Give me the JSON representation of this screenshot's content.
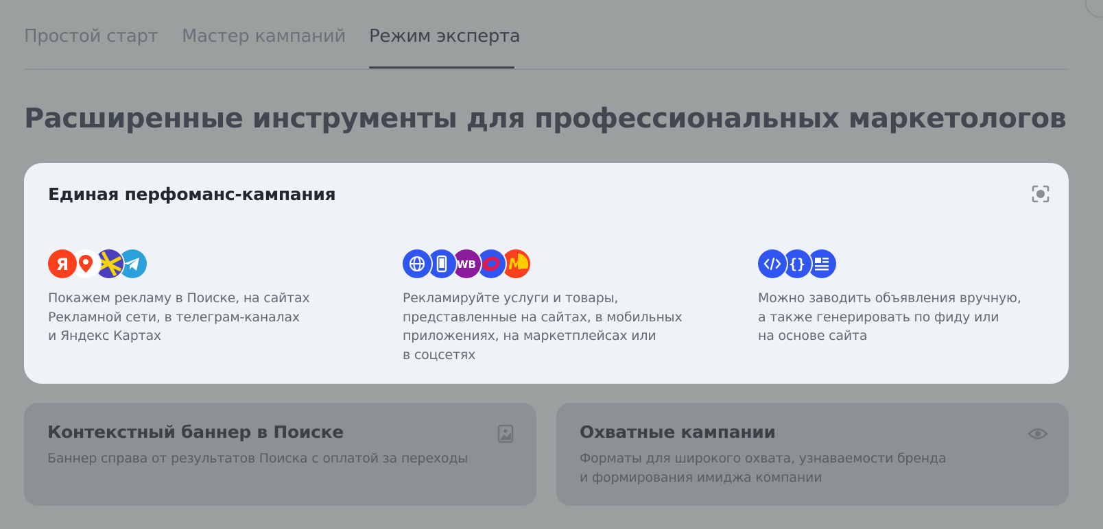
{
  "tabs": [
    {
      "label": "Простой старт"
    },
    {
      "label": "Мастер кампаний"
    },
    {
      "label": "Режим эксперта",
      "active": true
    }
  ],
  "page_title": "Расширенные инструменты для профессиональных маркетологов",
  "main_card": {
    "title": "Единая перфоманс-кампания",
    "expand_icon": "fullscreen-icon",
    "columns": [
      {
        "icons": [
          "yandex-search-icon",
          "yandex-maps-icon",
          "yandex-network-icon",
          "telegram-icon"
        ],
        "lines": [
          "Покажем рекламу в Поиске, на сайтах",
          "Рекламной сети, в телеграм-каналах",
          "и Яндекс Картах"
        ]
      },
      {
        "icons": [
          "website-icon",
          "mobile-app-icon",
          "wildberries-icon",
          "marketplace-icon",
          "yandex-market-icon"
        ],
        "icon_text": {
          "wildberries": "WB",
          "market": "M"
        },
        "lines": [
          "Рекламируйте услуги и товары,",
          "представленные на сайтах, в мобильных",
          "приложениях, на маркетплейсах или",
          "в соцсетях"
        ]
      },
      {
        "icons": [
          "code-icon",
          "feed-braces-icon",
          "site-content-icon"
        ],
        "icon_text": {
          "braces": "{}"
        },
        "lines": [
          "Можно заводить объявления вручную,",
          "а также генерировать по фиду или",
          "на основе сайта"
        ]
      }
    ]
  },
  "small_cards": [
    {
      "title": "Контекстный баннер в Поиске",
      "icon": "image-icon",
      "lines": [
        "Баннер справа от результатов Поиска с оплатой за переходы"
      ]
    },
    {
      "title": "Охватные кампании",
      "icon": "eye-icon",
      "lines": [
        "Форматы для широкого охвата, узнаваемости бренда",
        "и формирования имиджа компании"
      ]
    }
  ],
  "colors": {
    "overlay": "#9b9fa0",
    "card_bg": "#eff2f7",
    "yandex_red": "#fc3f1d",
    "telegram": "#2aa1da",
    "blue": "#2f56f2",
    "wb_purple": "#8b1a9c",
    "market_yellow": "#ffcc00"
  }
}
